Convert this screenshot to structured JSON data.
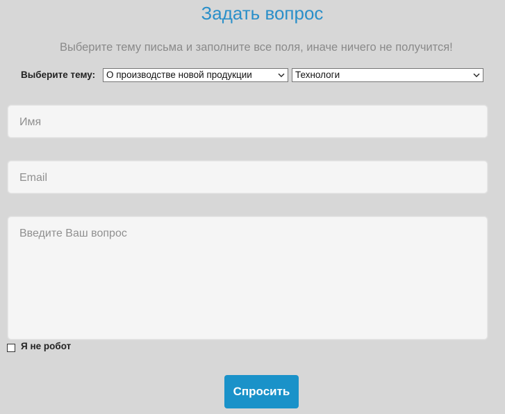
{
  "form": {
    "title": "Задать вопрос",
    "subtitle": "Выберите тему письма и заполните все поля, иначе ничего не получится!",
    "topic_label": "Выберите тему:",
    "topic_select_1": "О производстве новой продукции",
    "topic_select_2": "Технологи",
    "name_placeholder": "Имя",
    "email_placeholder": "Email",
    "question_placeholder": "Введите Ваш вопрос",
    "robot_label": "Я не робот",
    "robot_checked": false,
    "submit_label": "Спросить"
  },
  "colors": {
    "background": "#d7d7d7",
    "title": "#2a8fc9",
    "button": "#1a92c9",
    "field_bg": "#f5f5f5"
  }
}
